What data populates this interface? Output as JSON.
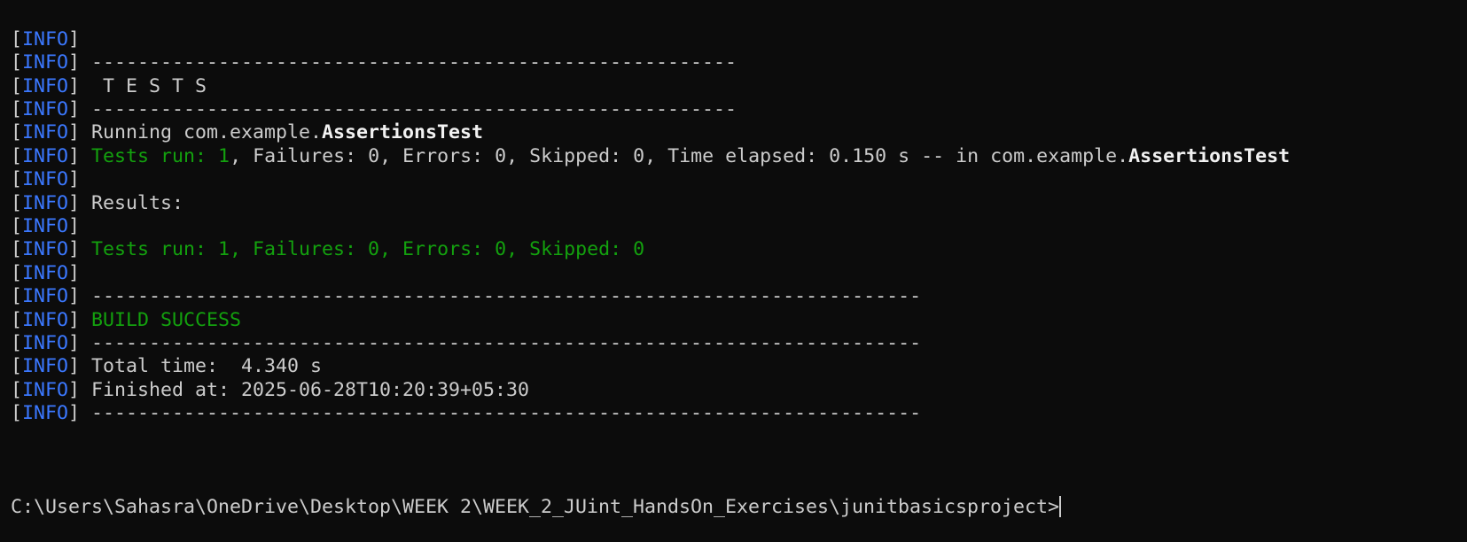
{
  "colors": {
    "background": "#0c0c0c",
    "text": "#cccccc",
    "info": "#3b78ff",
    "success": "#13a10e",
    "highlight": "#f2f2f2"
  },
  "terminal": {
    "lines": [
      [
        {
          "t": "[",
          "c": ""
        },
        {
          "t": "INFO",
          "c": "blue"
        },
        {
          "t": "]",
          "c": ""
        }
      ],
      [
        {
          "t": "[",
          "c": ""
        },
        {
          "t": "INFO",
          "c": "blue"
        },
        {
          "t": "] --------------------------------------------------------",
          "c": ""
        }
      ],
      [
        {
          "t": "[",
          "c": ""
        },
        {
          "t": "INFO",
          "c": "blue"
        },
        {
          "t": "]  T E S T S",
          "c": ""
        }
      ],
      [
        {
          "t": "[",
          "c": ""
        },
        {
          "t": "INFO",
          "c": "blue"
        },
        {
          "t": "] --------------------------------------------------------",
          "c": ""
        }
      ],
      [
        {
          "t": "[",
          "c": ""
        },
        {
          "t": "INFO",
          "c": "blue"
        },
        {
          "t": "] Running com.example.",
          "c": ""
        },
        {
          "t": "AssertionsTest",
          "c": "bold"
        }
      ],
      [
        {
          "t": "[",
          "c": ""
        },
        {
          "t": "INFO",
          "c": "blue"
        },
        {
          "t": "] ",
          "c": ""
        },
        {
          "t": "Tests run: 1",
          "c": "green"
        },
        {
          "t": ", Failures: 0, Errors: 0, Skipped: 0, Time elapsed: 0.150 s -- in com.example.",
          "c": ""
        },
        {
          "t": "AssertionsTest",
          "c": "bold"
        }
      ],
      [
        {
          "t": "[",
          "c": ""
        },
        {
          "t": "INFO",
          "c": "blue"
        },
        {
          "t": "]",
          "c": ""
        }
      ],
      [
        {
          "t": "[",
          "c": ""
        },
        {
          "t": "INFO",
          "c": "blue"
        },
        {
          "t": "] Results:",
          "c": ""
        }
      ],
      [
        {
          "t": "[",
          "c": ""
        },
        {
          "t": "INFO",
          "c": "blue"
        },
        {
          "t": "]",
          "c": ""
        }
      ],
      [
        {
          "t": "[",
          "c": ""
        },
        {
          "t": "INFO",
          "c": "blue"
        },
        {
          "t": "] ",
          "c": ""
        },
        {
          "t": "Tests run: 1, Failures: 0, Errors: 0, Skipped: 0",
          "c": "green"
        }
      ],
      [
        {
          "t": "[",
          "c": ""
        },
        {
          "t": "INFO",
          "c": "blue"
        },
        {
          "t": "]",
          "c": ""
        }
      ],
      [
        {
          "t": "[",
          "c": ""
        },
        {
          "t": "INFO",
          "c": "blue"
        },
        {
          "t": "] ------------------------------------------------------------------------",
          "c": ""
        }
      ],
      [
        {
          "t": "[",
          "c": ""
        },
        {
          "t": "INFO",
          "c": "blue"
        },
        {
          "t": "] ",
          "c": ""
        },
        {
          "t": "BUILD SUCCESS",
          "c": "green"
        }
      ],
      [
        {
          "t": "[",
          "c": ""
        },
        {
          "t": "INFO",
          "c": "blue"
        },
        {
          "t": "] ------------------------------------------------------------------------",
          "c": ""
        }
      ],
      [
        {
          "t": "[",
          "c": ""
        },
        {
          "t": "INFO",
          "c": "blue"
        },
        {
          "t": "] Total time:  4.340 s",
          "c": ""
        }
      ],
      [
        {
          "t": "[",
          "c": ""
        },
        {
          "t": "INFO",
          "c": "blue"
        },
        {
          "t": "] Finished at: 2025-06-28T10:20:39+05:30",
          "c": ""
        }
      ],
      [
        {
          "t": "[",
          "c": ""
        },
        {
          "t": "INFO",
          "c": "blue"
        },
        {
          "t": "] ------------------------------------------------------------------------",
          "c": ""
        }
      ],
      []
    ],
    "prompt": "C:\\Users\\Sahasra\\OneDrive\\Desktop\\WEEK 2\\WEEK_2_JUint_HandsOn_Exercises\\junitbasicsproject>"
  }
}
